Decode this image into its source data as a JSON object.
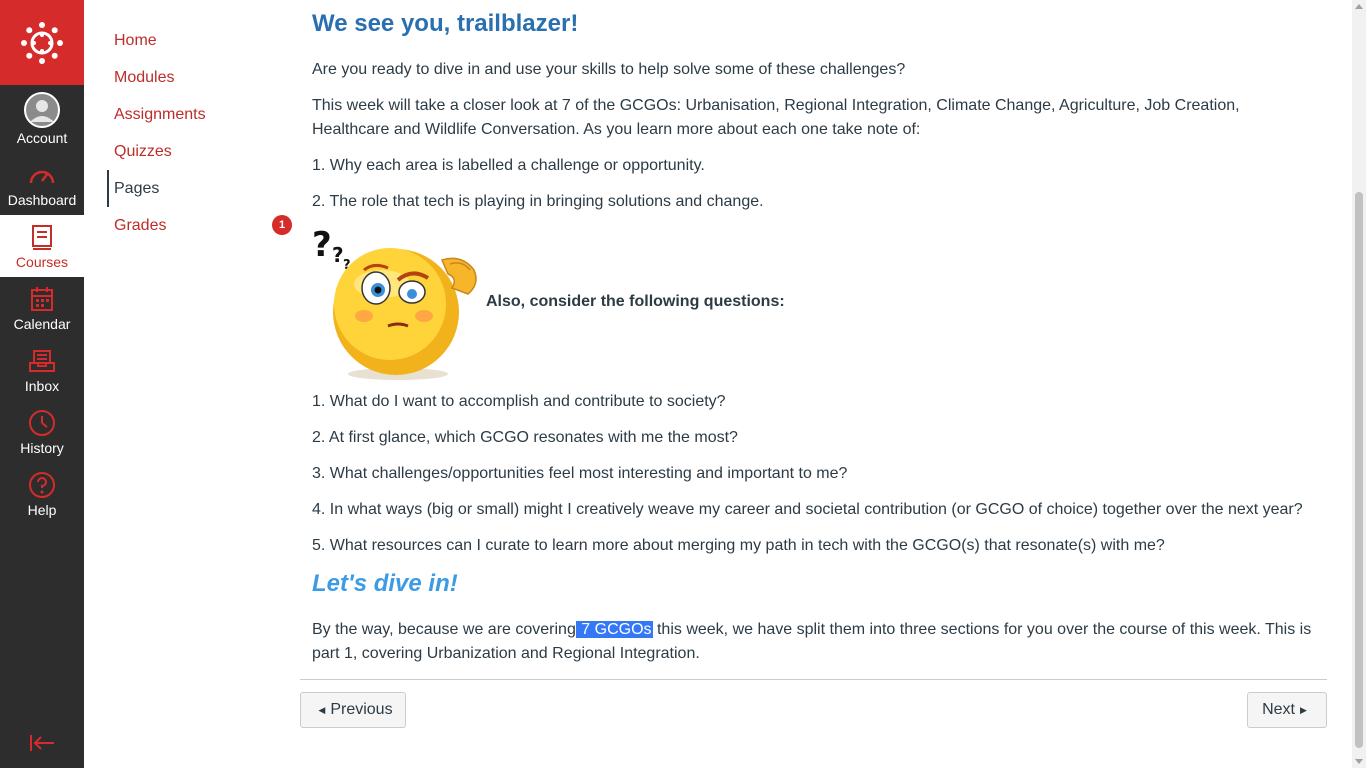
{
  "global_nav": {
    "items": [
      {
        "label": "Account",
        "icon": "avatar-icon"
      },
      {
        "label": "Dashboard",
        "icon": "dashboard-icon"
      },
      {
        "label": "Courses",
        "icon": "courses-icon"
      },
      {
        "label": "Calendar",
        "icon": "calendar-icon"
      },
      {
        "label": "Inbox",
        "icon": "inbox-icon"
      },
      {
        "label": "History",
        "icon": "history-icon"
      },
      {
        "label": "Help",
        "icon": "help-icon"
      }
    ],
    "active": "Courses",
    "colors": {
      "brand": "#d52b2b",
      "nav_bg": "#2d2d2d",
      "active_text": "#c52d28"
    }
  },
  "course_nav": {
    "items": [
      {
        "label": "Home"
      },
      {
        "label": "Modules"
      },
      {
        "label": "Assignments"
      },
      {
        "label": "Quizzes"
      },
      {
        "label": "Pages"
      },
      {
        "label": "Grades",
        "badge": "1"
      }
    ],
    "active": "Pages",
    "colors": {
      "link": "#bd2d2a"
    }
  },
  "page": {
    "title": "We see you, trailblazer!",
    "intro": "Are you ready to dive in and use your skills to help solve some of these challenges?",
    "week_text": "This week will take a closer look at 7 of the GCGOs: Urbanisation, Regional Integration, Climate Change, Agriculture, Job Creation, Healthcare and Wildlife Conversation. As you learn more about each one take note of:",
    "note_points": [
      "1. Why each area is labelled a challenge or opportunity.",
      "2. The role that tech is playing in bringing solutions and change."
    ],
    "questions_label": "Also, consider the following questions:",
    "questions": [
      "1. What do I want to accomplish and contribute to society?",
      "2. At first glance, which GCGO resonates with me the most?",
      "3. What challenges/opportunities feel most interesting and important to me?",
      "4. In what ways (big or small) might I creatively weave my career and societal contribution (or GCGO of choice) together over the next year?",
      "5. What resources can I curate to learn more about merging my path in tech with the GCGO(s) that resonate(s) with me?"
    ],
    "dive_heading": "Let's dive in!",
    "closing_before": "By the way, because we are covering",
    "closing_highlight": " 7 GCGOs",
    "closing_after": " this week, we have split them into three sections for you over the course of this week. This is part 1, covering Urbanization and Regional Integration.",
    "colors": {
      "title": "#2a6fb0",
      "dive": "#3b9be4",
      "highlight": "#3478f6"
    }
  },
  "footer_nav": {
    "previous_label": "Previous",
    "next_label": "Next"
  }
}
